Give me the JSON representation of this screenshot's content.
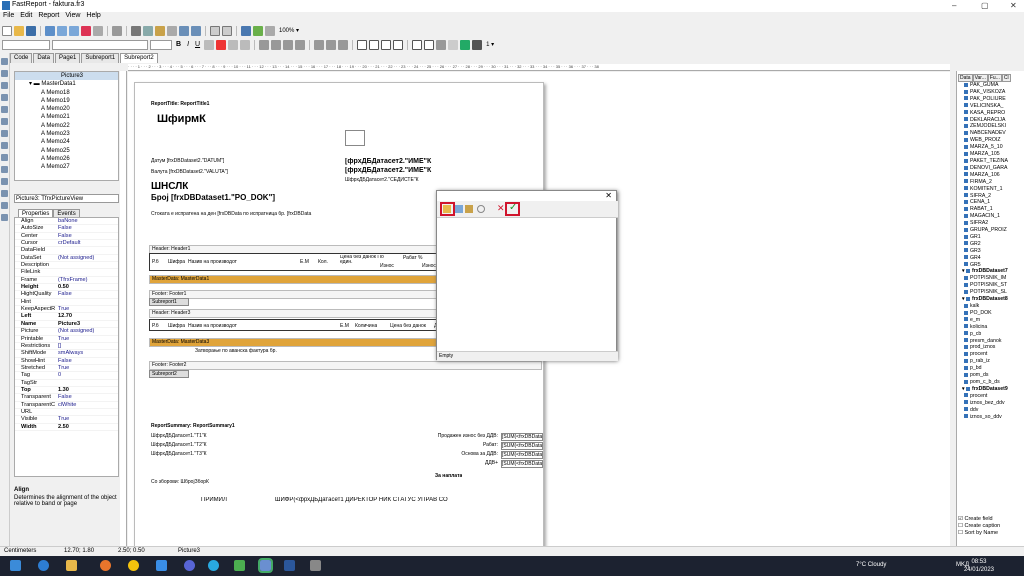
{
  "window": {
    "title": "FastReport - faktura.fr3",
    "min": "–",
    "max": "▢",
    "close": "✕"
  },
  "menu": [
    "File",
    "Edit",
    "Report",
    "View",
    "Help"
  ],
  "toolbar": {
    "zoom": "100% ▾",
    "fontsize": "1 ▾"
  },
  "page_tabs": [
    "Code",
    "Data",
    "Page1",
    "Subreport1",
    "Subreport2"
  ],
  "tree": [
    {
      "label": "Picture3",
      "indent": 3
    },
    {
      "label": "MasterData1",
      "indent": 1
    },
    {
      "label": "Memo18",
      "indent": 2
    },
    {
      "label": "Memo19",
      "indent": 2
    },
    {
      "label": "Memo20",
      "indent": 2
    },
    {
      "label": "Memo21",
      "indent": 2
    },
    {
      "label": "Memo22",
      "indent": 2
    },
    {
      "label": "Memo23",
      "indent": 2
    },
    {
      "label": "Memo24",
      "indent": 2
    },
    {
      "label": "Memo25",
      "indent": 2
    },
    {
      "label": "Memo26",
      "indent": 2
    },
    {
      "label": "Memo27",
      "indent": 2
    }
  ],
  "object_combo": "Picture3: TfrxPictureView",
  "props_tabs": [
    "Properties",
    "Events"
  ],
  "props": [
    {
      "k": "Align",
      "v": "baNone"
    },
    {
      "k": "AutoSize",
      "v": "False"
    },
    {
      "k": "Center",
      "v": "False"
    },
    {
      "k": "Cursor",
      "v": "crDefault"
    },
    {
      "k": "DataField",
      "v": ""
    },
    {
      "k": "DataSet",
      "v": "(Not assigned)"
    },
    {
      "k": "Description",
      "v": ""
    },
    {
      "k": "FileLink",
      "v": ""
    },
    {
      "k": "Frame",
      "v": "(TfrxFrame)"
    },
    {
      "k": "Height",
      "v": "0.50",
      "b": true
    },
    {
      "k": "HightQuality",
      "v": "False"
    },
    {
      "k": "Hint",
      "v": ""
    },
    {
      "k": "KeepAspectR",
      "v": "True"
    },
    {
      "k": "Left",
      "v": "12.70",
      "b": true
    },
    {
      "k": "Name",
      "v": "Picture3",
      "b": true
    },
    {
      "k": "Picture",
      "v": "(Not assigned)"
    },
    {
      "k": "Printable",
      "v": "True"
    },
    {
      "k": "Restrictions",
      "v": "[]"
    },
    {
      "k": "ShiftMode",
      "v": "smAlways"
    },
    {
      "k": "ShowHint",
      "v": "False"
    },
    {
      "k": "Stretched",
      "v": "True"
    },
    {
      "k": "Tag",
      "v": "0"
    },
    {
      "k": "TagStr",
      "v": ""
    },
    {
      "k": "Top",
      "v": "1.30",
      "b": true
    },
    {
      "k": "Transparent",
      "v": "False"
    },
    {
      "k": "TransparentC",
      "v": "clWhite"
    },
    {
      "k": "URL",
      "v": ""
    },
    {
      "k": "Visible",
      "v": "True"
    },
    {
      "k": "Width",
      "v": "2.50",
      "b": true
    }
  ],
  "help": {
    "title": "Align",
    "text": "Determines the alignment of the object relative to band or page"
  },
  "status": {
    "units": "Centimeters",
    "pos": "12.70; 1.80",
    "size": "2.50; 0.50",
    "obj": "Picture3"
  },
  "report": {
    "title_band": "ReportTitle: ReportTitle1",
    "firm": "ШфирмК",
    "datum": "Датум [frxDBDataset2.\"DATUM\"]",
    "valuta": "Валута [frxDBDataset2.\"VALUTA\"]",
    "shclk": "ШНСЛК",
    "broj": "Број [frxDBDataset1.\"PO_DOK\"]",
    "issued": "Стоката е испратена на ден [frxDBData по испратница бр. [frxDBData",
    "ime": "[фрxДБДатасет2.\"ИМЕ\"К",
    "ime2": "[фрxДБДатасет2.\"ИМЕ\"К",
    "sedis": "ШфрxДБДатасет2.\"СЕДИСТЕ\"К",
    "header1": "Header: Header1",
    "cols1": [
      "Р.б",
      "Шифра",
      "Назив на производот",
      "Е.М",
      "Кол.",
      "Цена без данок По един.",
      "Износ",
      "Рабат %",
      "Износ"
    ],
    "md1": "MasterData: MasterData1",
    "footer1": "Footer: Footer1",
    "sub1": "Subreport1",
    "header3": "Header: Header3",
    "cols3": [
      "Р.б",
      "Шифра",
      "Назив на производот",
      "Е.М",
      "Количина",
      "Цена без данок",
      "Д"
    ],
    "md3": "MasterData: MasterData3",
    "md3text": "Затворање по аванска фактура бр.",
    "footer2": "Footer: Footer2",
    "sub2": "Subreport2",
    "summary": "ReportSummary: ReportSummary1",
    "t1": "ШфрxДБДатасет1.\"Т1\"К",
    "t2": "ШфрxДБДатасет1.\"Т2\"К",
    "t3": "ШфрxДБДатасет1.\"Т3\"К",
    "prod": "Продажен износ без ДДВ:",
    "rabat": "Рабат:",
    "osnova": "Основа за ДДВ:",
    "ddv": "ДДВ+",
    "naplata": "За наплата",
    "sumtxt": "[SUM(<frxDBDatas",
    "zbor": "Со зборови: ШбројЗборК",
    "primil": "ПРИМИЛ",
    "sign": "ШИФР(<фрxДБДатасет1 ДИРЕКТОР НИК СТАТУС УПРАВ СО"
  },
  "dialog": {
    "status": "Empty"
  },
  "rtabs": [
    "Data",
    "Var...",
    "Fu...",
    "Cl"
  ],
  "fields": [
    {
      "t": "PAK_GUMA"
    },
    {
      "t": "PAK_VISKOZA"
    },
    {
      "t": "PAK_POLIURE"
    },
    {
      "t": "VELICINSKA_"
    },
    {
      "t": "KASA_REPRO"
    },
    {
      "t": "DEKLARACIJA"
    },
    {
      "t": "ZEMJODELSKI"
    },
    {
      "t": "NABCENADEV"
    },
    {
      "t": "WEB_PROIZ"
    },
    {
      "t": "MARZA_5_10"
    },
    {
      "t": "MARZA_105"
    },
    {
      "t": "PAKET_TEZINA"
    },
    {
      "t": "DENOVI_GARA"
    },
    {
      "t": "MARZA_106"
    },
    {
      "t": "FIRMA_2"
    },
    {
      "t": "KOMITENT_1"
    },
    {
      "t": "SIFRA_2"
    },
    {
      "t": "CENA_1"
    },
    {
      "t": "RABAT_1"
    },
    {
      "t": "MAGACIN_1"
    },
    {
      "t": "SIFRA2"
    },
    {
      "t": "GRUPA_PROIZ"
    },
    {
      "t": "GR1"
    },
    {
      "t": "GR2"
    },
    {
      "t": "GR3"
    },
    {
      "t": "GR4"
    },
    {
      "t": "GR5"
    },
    {
      "t": "frxDBDataset7",
      "g": true
    },
    {
      "t": "POTPISNIK_IM"
    },
    {
      "t": "POTPISNIK_ST"
    },
    {
      "t": "POTPISNIK_SL"
    },
    {
      "t": "frxDBDataset8",
      "g": true
    },
    {
      "t": "kalk"
    },
    {
      "t": "PO_DOK"
    },
    {
      "t": "e_m"
    },
    {
      "t": "kolicina"
    },
    {
      "t": "p_cb"
    },
    {
      "t": "presm_danok"
    },
    {
      "t": "prod_iznos"
    },
    {
      "t": "procent"
    },
    {
      "t": "p_rab_iz"
    },
    {
      "t": "p_bd"
    },
    {
      "t": "pom_ds"
    },
    {
      "t": "pom_c_b_ds"
    },
    {
      "t": "frxDBDataset9",
      "g": true
    },
    {
      "t": "procent"
    },
    {
      "t": "iznos_bez_ddv"
    },
    {
      "t": "ddv"
    },
    {
      "t": "iznos_so_ddv"
    }
  ],
  "checks": [
    "Create field",
    "Create caption",
    "Sort by Name"
  ],
  "clock": {
    "time": "08:53",
    "date": "24/01/2023"
  },
  "weather": "7°C Cloudy",
  "lang": "MKД",
  "colors": {
    "accent": "#e0a43a",
    "red": "#d0142c"
  }
}
